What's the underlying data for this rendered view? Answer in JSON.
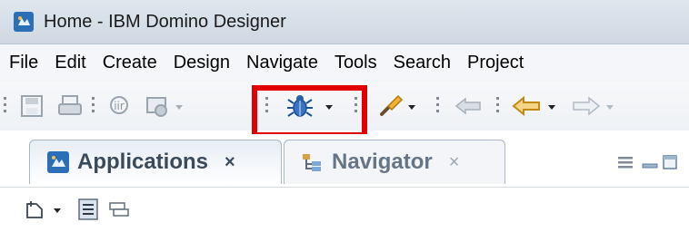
{
  "window": {
    "title": "Home - IBM Domino Designer"
  },
  "menu": {
    "items": [
      "File",
      "Edit",
      "Create",
      "Design",
      "Navigate",
      "Tools",
      "Search",
      "Project"
    ]
  },
  "toolbar": {
    "icons": [
      "save-icon",
      "print-icon",
      "properties-icon",
      "screen-icon",
      "debug-bug-icon",
      "brush-icon",
      "back-link-icon",
      "back-arrow-icon",
      "forward-arrow-icon"
    ],
    "highlight_color": "#e10000"
  },
  "tabs": {
    "active_label": "Applications",
    "active_close": "×",
    "inactive_label": "Navigator",
    "inactive_close": "×"
  }
}
